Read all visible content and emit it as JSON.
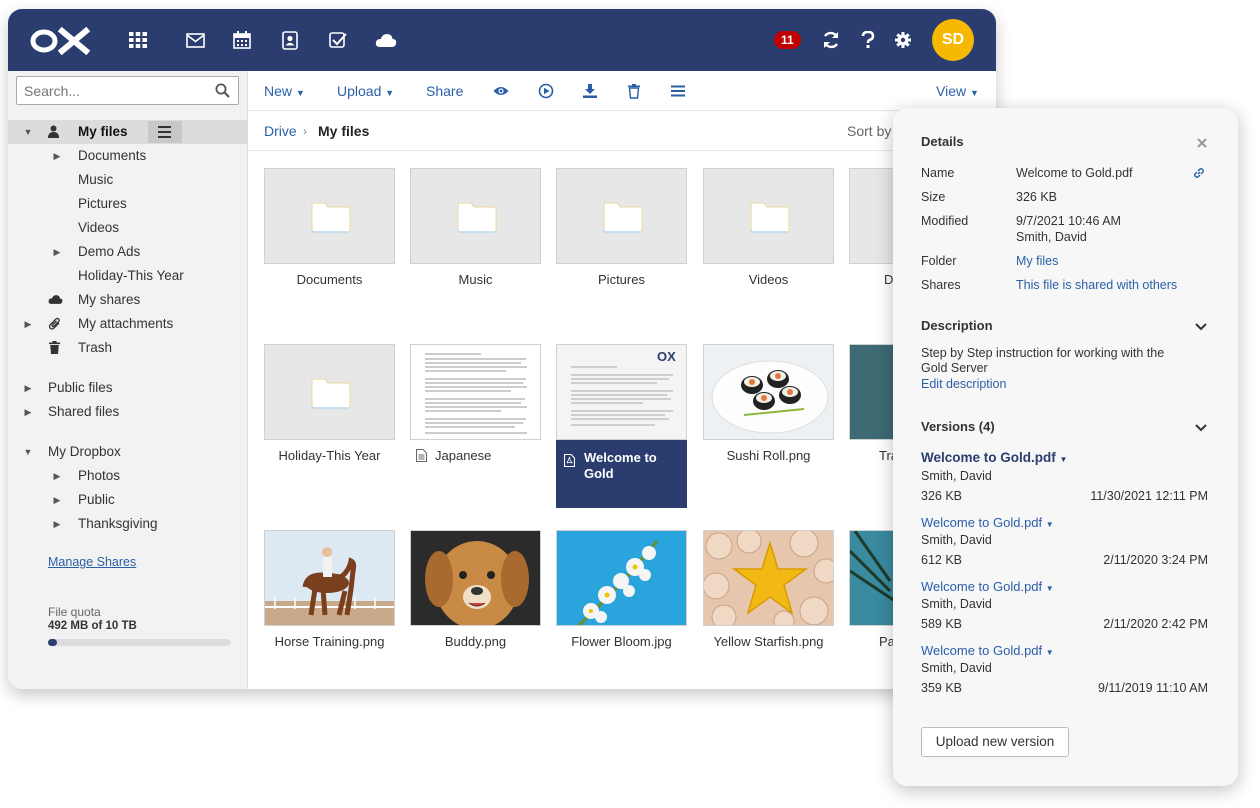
{
  "header": {
    "logo_text": "OX",
    "apps": [
      "apps-grid",
      "mail",
      "calendar",
      "address-book",
      "tasks",
      "drive"
    ],
    "notification_count": "11",
    "avatar_initials": "SD",
    "accent_color": "#2a3d6e",
    "avatar_color": "#f6b800",
    "badge_color": "#c00000"
  },
  "sidebar": {
    "search_placeholder": "Search...",
    "tree": [
      {
        "label": "My files",
        "selected": true
      },
      {
        "label": "Documents"
      },
      {
        "label": "Music"
      },
      {
        "label": "Pictures"
      },
      {
        "label": "Videos"
      },
      {
        "label": "Demo Ads"
      },
      {
        "label": "Holiday-This Year"
      },
      {
        "label": "My shares"
      },
      {
        "label": "My attachments"
      },
      {
        "label": "Trash"
      },
      {
        "label": "Public files"
      },
      {
        "label": "Shared files"
      },
      {
        "label": "My Dropbox"
      },
      {
        "label": "Photos"
      },
      {
        "label": "Public"
      },
      {
        "label": "Thanksgiving"
      }
    ],
    "manage_shares": "Manage Shares",
    "quota_label": "File quota",
    "quota_value": "492 MB of 10 TB",
    "quota_fraction": 0.05
  },
  "toolbar": {
    "new_label": "New",
    "upload_label": "Upload",
    "share_label": "Share",
    "view_label": "View"
  },
  "breadcrumb": {
    "root": "Drive",
    "current": "My files",
    "sort_label": "Sort by"
  },
  "files": [
    {
      "name": "Documents",
      "kind": "folder"
    },
    {
      "name": "Music",
      "kind": "folder"
    },
    {
      "name": "Pictures",
      "kind": "folder"
    },
    {
      "name": "Videos",
      "kind": "folder"
    },
    {
      "name": "D",
      "kind": "folder"
    },
    {
      "name": "Holiday-This Year",
      "kind": "folder"
    },
    {
      "name": "Japanese",
      "kind": "document"
    },
    {
      "name": "Welcome to Gold",
      "kind": "pdf",
      "selected": true
    },
    {
      "name": "Sushi Roll.png",
      "kind": "image"
    },
    {
      "name": "Tra",
      "kind": "image"
    },
    {
      "name": "Horse Training.png",
      "kind": "image"
    },
    {
      "name": "Buddy.png",
      "kind": "image"
    },
    {
      "name": "Flower Bloom.jpg",
      "kind": "image"
    },
    {
      "name": "Yellow Starfish.png",
      "kind": "image"
    },
    {
      "name": "Pal",
      "kind": "image"
    }
  ],
  "details": {
    "title": "Details",
    "name_label": "Name",
    "name_value": "Welcome to Gold.pdf",
    "size_label": "Size",
    "size_value": "326 KB",
    "modified_label": "Modified",
    "modified_value": "9/7/2021 10:46 AM",
    "modified_by": "Smith, David",
    "folder_label": "Folder",
    "folder_value": "My files",
    "shares_label": "Shares",
    "shares_value": "This file is shared with others"
  },
  "description": {
    "title": "Description",
    "text": "Step by Step instruction for working with the Gold Server",
    "edit_link": "Edit description"
  },
  "versions": {
    "title": "Versions (4)",
    "items": [
      {
        "name": "Welcome to Gold.pdf",
        "author": "Smith, David",
        "size": "326 KB",
        "date": "11/30/2021 12:11 PM"
      },
      {
        "name": "Welcome to Gold.pdf",
        "author": "Smith, David",
        "size": "612 KB",
        "date": "2/11/2020 3:24 PM"
      },
      {
        "name": "Welcome to Gold.pdf",
        "author": "Smith, David",
        "size": "589 KB",
        "date": "2/11/2020 2:42 PM"
      },
      {
        "name": "Welcome to Gold.pdf",
        "author": "Smith, David",
        "size": "359 KB",
        "date": "9/11/2019 11:10 AM"
      }
    ],
    "upload_button": "Upload new version"
  }
}
